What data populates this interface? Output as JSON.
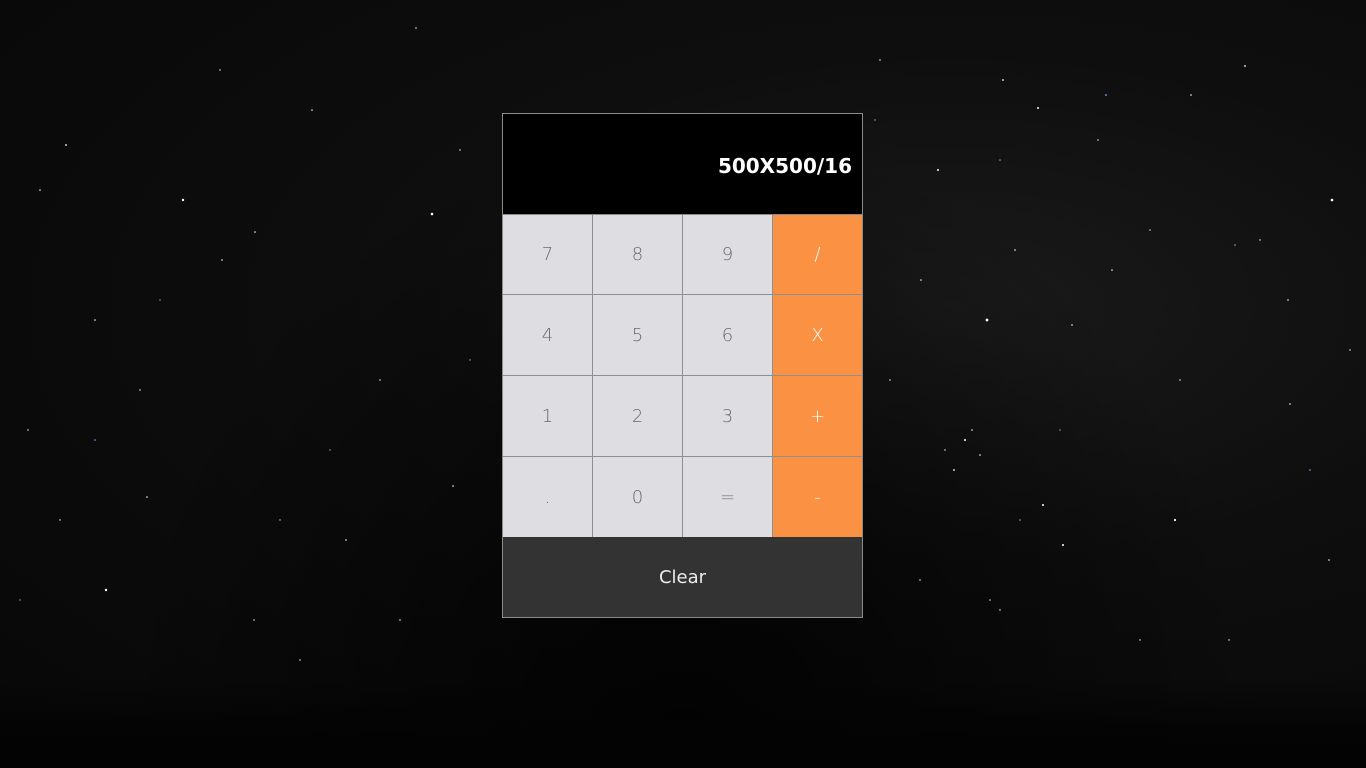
{
  "display": {
    "expression": "500X500/16"
  },
  "keypad": {
    "rows": [
      [
        "7",
        "8",
        "9",
        "/"
      ],
      [
        "4",
        "5",
        "6",
        "X"
      ],
      [
        "1",
        "2",
        "3",
        "+"
      ],
      [
        ".",
        "0",
        "=",
        "-"
      ]
    ]
  },
  "clear_label": "Clear",
  "colors": {
    "display_bg": "#000000",
    "number_key_bg": "#dedee2",
    "operator_key_bg": "#fb9142",
    "clear_bg": "#333333"
  }
}
